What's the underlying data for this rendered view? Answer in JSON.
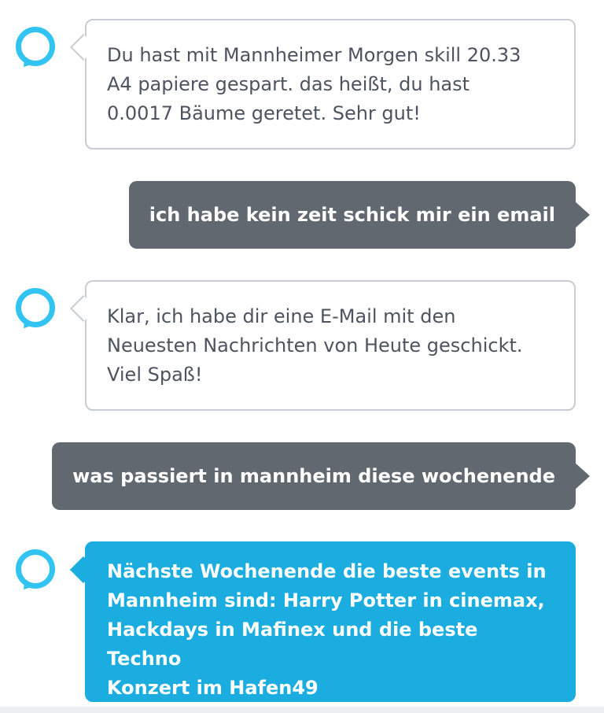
{
  "conversation": {
    "messages": [
      {
        "sender": "alexa",
        "text": "Du hast mit Mannheimer Morgen skill 20.33\nA4 papiere gespart. das heißt, du hast\n0.0017 Bäume geretet. Sehr gut!"
      },
      {
        "sender": "user",
        "text": "ich habe kein zeit schick mir ein email"
      },
      {
        "sender": "alexa",
        "text": "Klar, ich habe dir eine E-Mail mit den\nNeuesten Nachrichten von Heute geschickt.\nViel Spaß!"
      },
      {
        "sender": "user",
        "text": "was passiert in mannheim diese wochenende"
      },
      {
        "sender": "alexa",
        "text": "Nächste Wochenende die beste events in\nMannheim sind: Harry Potter in cinemax,\nHackdays in Mafinex und die beste Techno\nKonzert im Hafen49",
        "highlighted": true
      }
    ]
  },
  "colors": {
    "alexa_ring": "#31c4f3",
    "user_bubble": "#626870",
    "alexa_bubble_border": "#c7cdd2",
    "alexa_highlight_bubble": "#1bace0",
    "alexa_text": "#4d5460"
  },
  "icons": {
    "alexa_avatar": "alexa-ring-icon"
  }
}
